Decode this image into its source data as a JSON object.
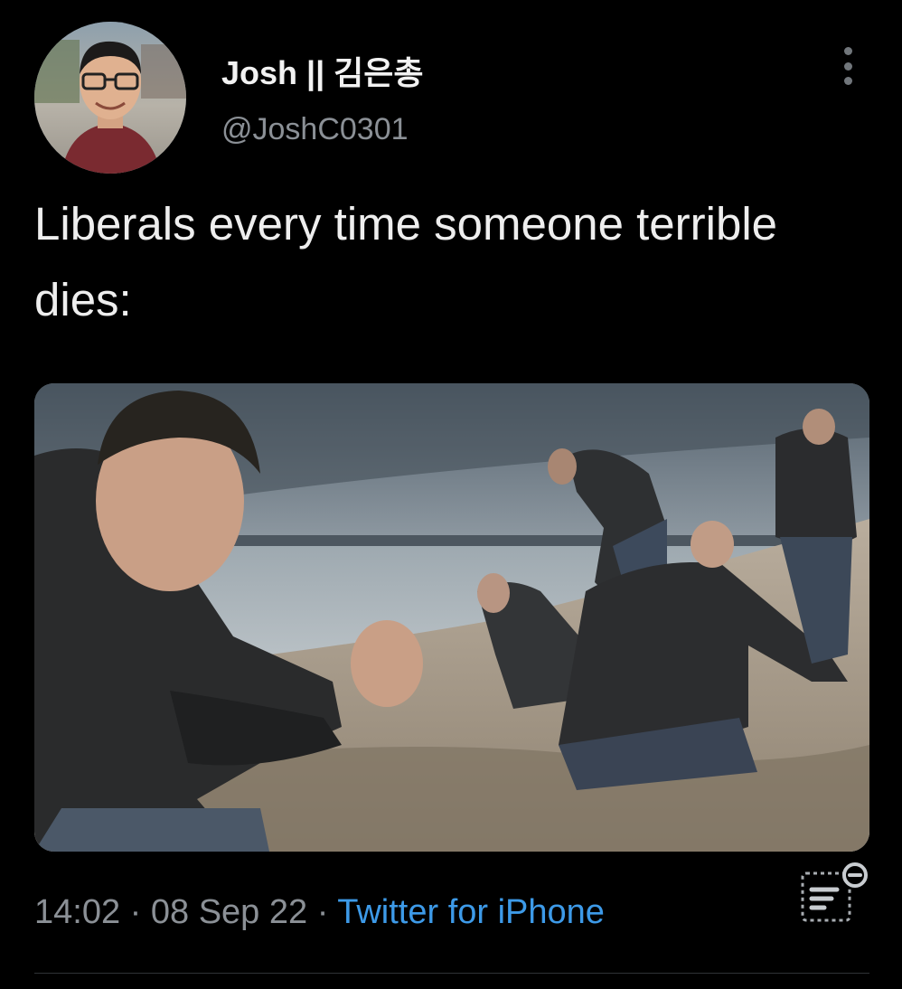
{
  "author": {
    "display_name": "Josh || 김은총",
    "handle": "@JoshC0301"
  },
  "tweet": {
    "text": "Liberals every time someone terrible dies:"
  },
  "meta": {
    "time": "14:02",
    "separator_1": "·",
    "date": "08 Sep 22",
    "separator_2": "·",
    "source": "Twitter for iPhone"
  },
  "icons": {
    "more": "more-vertical-icon",
    "analytics": "view-analytics-icon"
  },
  "colors": {
    "background": "#000000",
    "text_primary": "#e7e9ea",
    "text_secondary": "#8b9096",
    "link": "#3d9ae8",
    "divider": "#2f3336"
  }
}
